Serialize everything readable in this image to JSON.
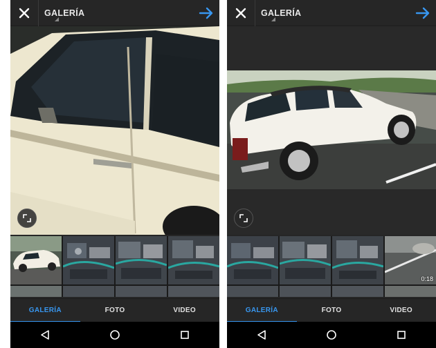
{
  "screens": [
    {
      "header": {
        "title": "GALERÍA"
      },
      "tabs": [
        {
          "label": "GALERÍA",
          "active": true
        },
        {
          "label": "FOTO",
          "active": false
        },
        {
          "label": "VIDEO",
          "active": false
        }
      ],
      "thumbnails": [
        {
          "icon": "car-photo"
        },
        {
          "icon": "engine-photo"
        },
        {
          "icon": "engine-photo"
        },
        {
          "icon": "engine-photo"
        }
      ]
    },
    {
      "header": {
        "title": "GALERÍA"
      },
      "tabs": [
        {
          "label": "GALERÍA",
          "active": true
        },
        {
          "label": "FOTO",
          "active": false
        },
        {
          "label": "VIDEO",
          "active": false
        }
      ],
      "thumbnails": [
        {
          "icon": "engine-photo"
        },
        {
          "icon": "engine-photo"
        },
        {
          "icon": "engine-photo"
        },
        {
          "icon": "video-thumbnail",
          "duration": "0:18"
        }
      ]
    }
  ],
  "colors": {
    "accent": "#3897f0",
    "background": "#262626",
    "navbar": "#000000"
  }
}
